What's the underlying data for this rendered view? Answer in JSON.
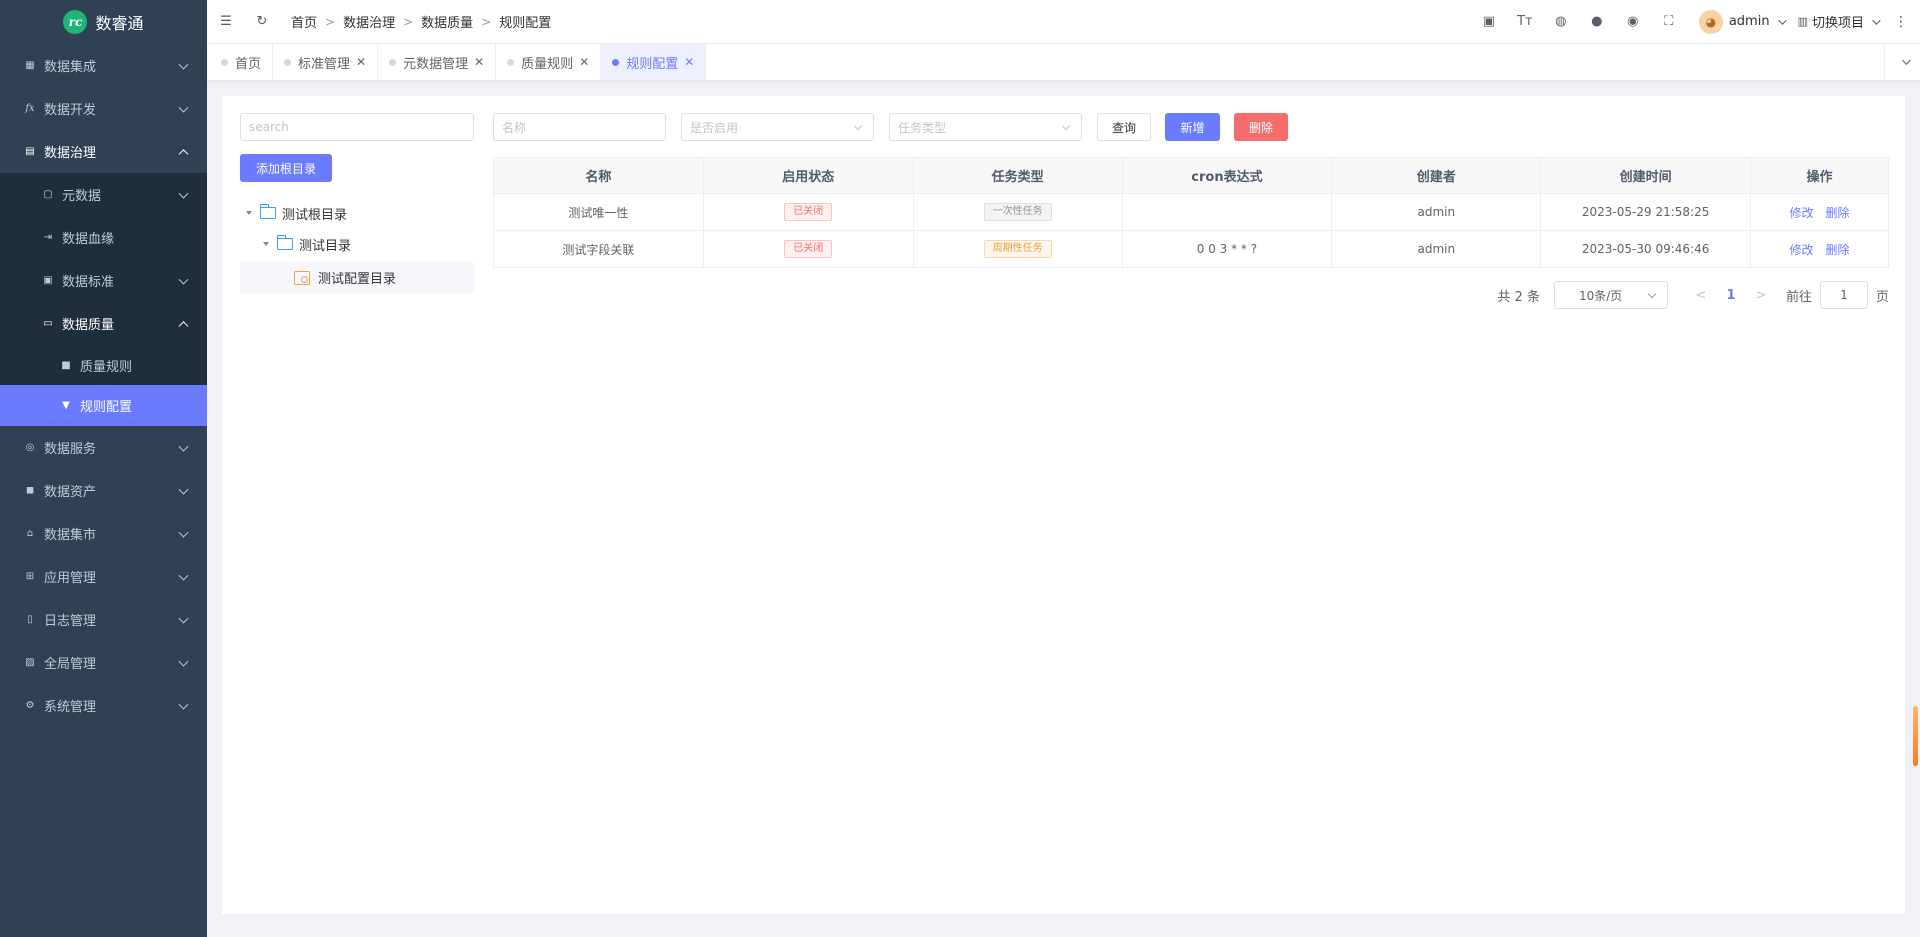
{
  "app": {
    "name": "数睿通"
  },
  "sidebar": {
    "items": [
      {
        "label": "数据集成",
        "icon": "table-icon"
      },
      {
        "label": "数据开发",
        "icon": "function-icon"
      },
      {
        "label": "数据治理",
        "icon": "grid-icon"
      },
      {
        "label": "元数据",
        "icon": "document-icon"
      },
      {
        "label": "数据血缘",
        "icon": "lineage-icon"
      },
      {
        "label": "数据标准",
        "icon": "standard-icon"
      },
      {
        "label": "数据质量",
        "icon": "quality-icon"
      },
      {
        "label": "质量规则",
        "icon": "lock-icon"
      },
      {
        "label": "规则配置",
        "icon": "brush-icon"
      },
      {
        "label": "数据服务",
        "icon": "service-icon"
      },
      {
        "label": "数据资产",
        "icon": "asset-icon"
      },
      {
        "label": "数据集市",
        "icon": "market-icon"
      },
      {
        "label": "应用管理",
        "icon": "apps-icon"
      },
      {
        "label": "日志管理",
        "icon": "log-icon"
      },
      {
        "label": "全局管理",
        "icon": "global-icon"
      },
      {
        "label": "系统管理",
        "icon": "settings-icon"
      }
    ]
  },
  "header": {
    "breadcrumb": [
      "首页",
      "数据治理",
      "数据质量",
      "规则配置"
    ],
    "user": "admin",
    "project": "切换项目"
  },
  "tabs": [
    {
      "label": "首页"
    },
    {
      "label": "标准管理"
    },
    {
      "label": "元数据管理"
    },
    {
      "label": "质量规则"
    },
    {
      "label": "规则配置"
    }
  ],
  "left": {
    "search_placeholder": "search",
    "add_root_label": "添加根目录",
    "tree": {
      "root": "测试根目录",
      "child": "测试目录",
      "leaf": "测试配置目录"
    }
  },
  "filters": {
    "name_placeholder": "名称",
    "enabled_placeholder": "是否启用",
    "task_type_placeholder": "任务类型",
    "query_label": "查询",
    "add_label": "新增",
    "delete_label": "删除"
  },
  "table": {
    "columns": [
      "名称",
      "启用状态",
      "任务类型",
      "cron表达式",
      "创建者",
      "创建时间",
      "操作"
    ],
    "rows": [
      {
        "name": "测试唯一性",
        "status": "已关闭",
        "task_type": "一次性任务",
        "cron": "",
        "creator": "admin",
        "created": "2023-05-29 21:58:25",
        "edit": "修改",
        "del": "删除"
      },
      {
        "name": "测试字段关联",
        "status": "已关闭",
        "task_type": "周期性任务",
        "cron": "0 0 3 * * ?",
        "creator": "admin",
        "created": "2023-05-30 09:46:46",
        "edit": "修改",
        "del": "删除"
      }
    ]
  },
  "pagination": {
    "total": "共 2 条",
    "page_size": "10条/页",
    "current": "1",
    "goto_prefix": "前往",
    "goto_value": "1",
    "goto_suffix": "页"
  },
  "colors": {
    "primary": "#6b7bff",
    "sidebar": "#304156",
    "danger": "#f56c6c"
  }
}
